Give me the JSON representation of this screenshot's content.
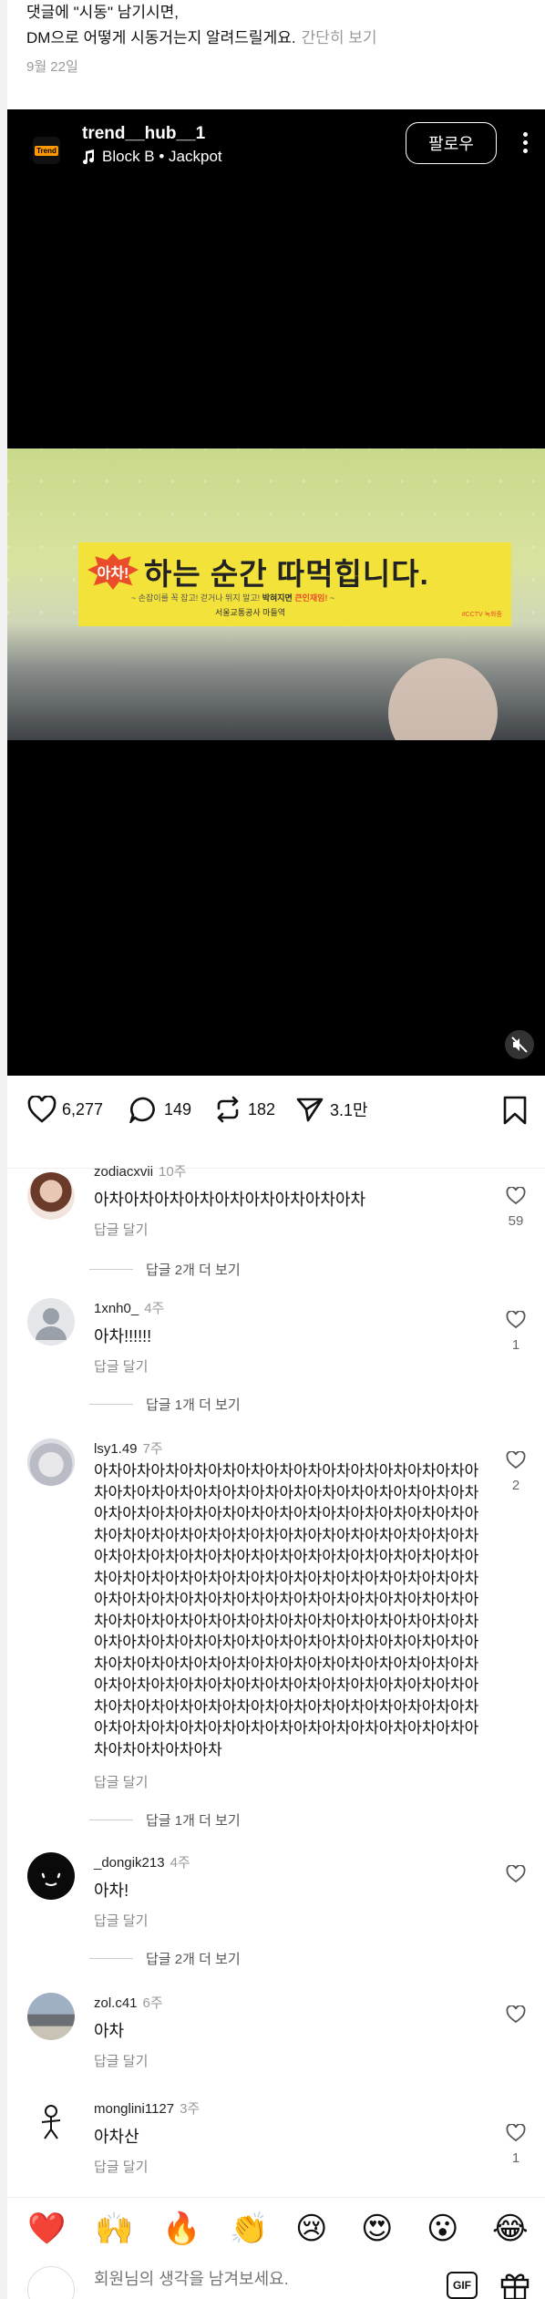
{
  "post": {
    "caption_line1": "댓글에 \"시동\" 남기시면,",
    "caption_line2": "DM으로 어떻게 시동거는지 알려드릴게요.",
    "caption_more": "간단히 보기",
    "date": "9월 22일"
  },
  "reel": {
    "account_logo_text": "Trend",
    "username": "trend__hub__1",
    "music": "Block B • Jackpot",
    "follow_label": "팔로우",
    "banner": {
      "burst_text": "아차!",
      "main_text": "하는 순간 따먹힙니다.",
      "sub_text": "~ 손잡이를 꼭 잡고! 걷거나 뛰지 말고!",
      "sub_text_bold": "박혀지면",
      "sub_text_red": "큰인재임!",
      "org_text": "서울교통공사 마들역",
      "tag_text": "#CCTV 녹화중"
    }
  },
  "actions": {
    "likes": "6,277",
    "comments": "149",
    "reposts": "182",
    "shares": "3.1만"
  },
  "comments": [
    {
      "user": "zodiacxvii",
      "time": "10주",
      "text": "아차아차아차아차아차아차아차아차아차",
      "reply": "답글 달기",
      "likes": "59",
      "view_replies": "답글 2개 더 보기"
    },
    {
      "user": "1xnh0_",
      "time": "4주",
      "text": "아차!!!!!!",
      "reply": "답글 달기",
      "likes": "1",
      "view_replies": "답글 1개 더 보기"
    },
    {
      "user": "lsy1.49",
      "time": "7주",
      "text": "아차아차아차아차아차아차아차아차아차아차아차아차아차아차아차아차아차아차아차아차아차아차아차아차아차아차아차아차아차아차아차아차아차아차아차아차아차아차아차아차아차아차아차아차아차아차아차아차아차아차아차아차아차아차아차아차아차아차아차아차아차아차아차아차아차아차아차아차아차아차아차아차아차아차아차아차아차아차아차아차아차아차아차아차아차아차아차아차아차아차아차아차아차아차아차아차아차아차아차아차아차아차아차아차아차아차아차아차아차아차아차아차아차아차아차아차아차아차아차아차아차아차아차아차아차아차아차아차아차아차아차아차아차아차아차아차아차아차아차아차아차아차아차아차아차아차아차아차아차아차아차아차아차아차아차아차아차아차아차아차아차아차아차아차아차아차아차아차아차아차아차아차아차아차아차아차아차아차아차아차",
      "reply": "답글 달기",
      "likes": "2",
      "view_replies": "답글 1개 더 보기"
    },
    {
      "user": "_dongik213",
      "time": "4주",
      "text": "아차!",
      "reply": "답글 달기",
      "likes": "",
      "view_replies": "답글 2개 더 보기"
    },
    {
      "user": "zol.c41",
      "time": "6주",
      "text": "아차",
      "reply": "답글 달기",
      "likes": "",
      "view_replies": ""
    },
    {
      "user": "monglini1127",
      "time": "3주",
      "text": "아차산",
      "reply": "답글 달기",
      "likes": "1",
      "view_replies": ""
    }
  ],
  "emoji_bar": [
    "❤️",
    "🙌",
    "🔥",
    "👏",
    "😢",
    "😍",
    "😮",
    "😂"
  ],
  "input": {
    "placeholder": "회원님의 생각을 남겨보세요.",
    "gif_label": "GIF"
  }
}
